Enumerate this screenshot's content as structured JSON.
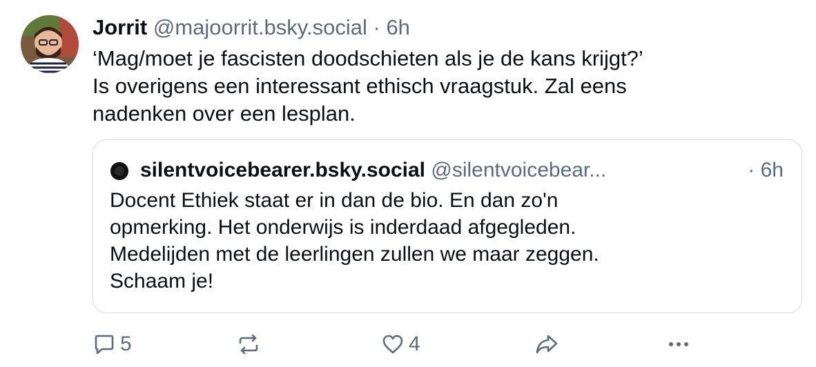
{
  "post": {
    "author_name": "Jorrit",
    "author_handle": "@majoorrit.bsky.social",
    "separator": "·",
    "time": "6h",
    "text_lines": [
      "‘Mag/moet je fascisten doodschieten als je de kans krijgt?’",
      "Is overigens een interessant ethisch vraagstuk. Zal eens",
      "nadenken over een lesplan."
    ]
  },
  "quote": {
    "author_name": "silentvoicebearer.bsky.social",
    "author_handle": "@silentvoicebear...",
    "separator_time": "· 6h",
    "text_lines": [
      "Docent Ethiek staat er in dan de bio. En dan zo'n",
      "opmerking. Het onderwijs is inderdaad afgegleden.",
      "Medelijden met de leerlingen zullen we maar zeggen.",
      "Schaam je!"
    ]
  },
  "actions": {
    "reply_icon": "speech-bubble-icon",
    "reply_count": "5",
    "repost_icon": "repost-arrows-icon",
    "like_icon": "heart-icon",
    "like_count": "4",
    "share_icon": "share-arrow-icon",
    "more_icon": "more-dots-icon"
  },
  "colors": {
    "text": "#0b0f14",
    "muted": "#5b6b7b",
    "border": "#d4dbe2"
  }
}
